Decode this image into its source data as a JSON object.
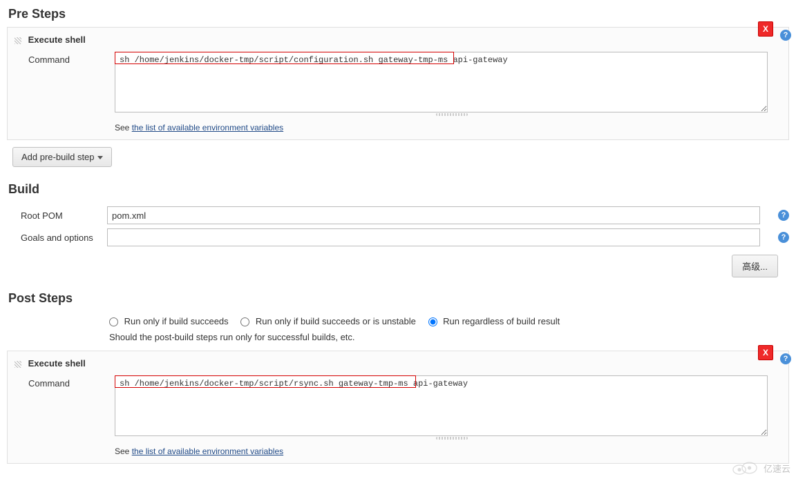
{
  "preSteps": {
    "heading": "Pre Steps",
    "step": {
      "title": "Execute shell",
      "deleteLabel": "X",
      "commandLabel": "Command",
      "commandValue": "sh /home/jenkins/docker-tmp/script/configuration.sh gateway-tmp-ms api-gateway",
      "seeText": "See ",
      "seeLink": "the list of available environment variables"
    },
    "addButton": "Add pre-build step"
  },
  "build": {
    "heading": "Build",
    "rootPomLabel": "Root POM",
    "rootPomValue": "pom.xml",
    "goalsLabel": "Goals and options",
    "goalsValue": "",
    "advancedLabel": "高级..."
  },
  "postSteps": {
    "heading": "Post Steps",
    "radios": {
      "succeeds": "Run only if build succeeds",
      "unstable": "Run only if build succeeds or is unstable",
      "regardless": "Run regardless of build result"
    },
    "hint": "Should the post-build steps run only for successful builds, etc.",
    "step": {
      "title": "Execute shell",
      "deleteLabel": "X",
      "commandLabel": "Command",
      "commandValue": "sh /home/jenkins/docker-tmp/script/rsync.sh gateway-tmp-ms api-gateway",
      "seeText": "See ",
      "seeLink": "the list of available environment variables"
    }
  },
  "watermark": "亿速云"
}
